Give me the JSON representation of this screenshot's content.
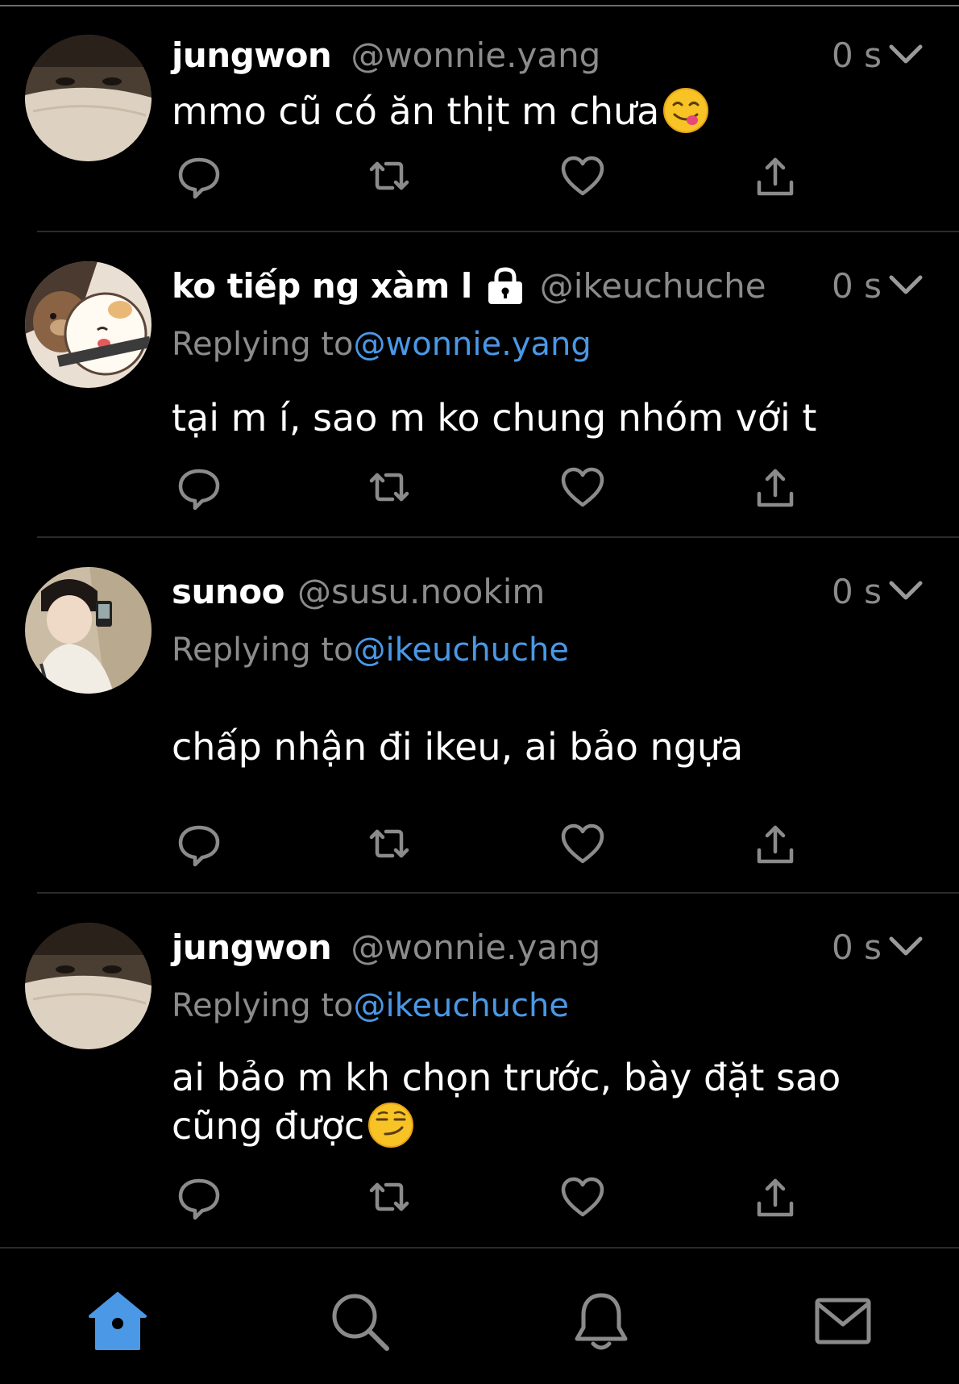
{
  "tweets": [
    {
      "name": "jungwon",
      "handle": "@wonnie.yang",
      "time": "0 s",
      "replying_prefix": "",
      "replying_to": "",
      "text": "mmo cũ có ăn thịt m chưa",
      "emoji": "savoring-face-emoji"
    },
    {
      "name": "ko tiếp ng xàm l",
      "handle": "@ikeuchuche",
      "time": "0 s",
      "replying_prefix": "Replying to",
      "replying_to": "@wonnie.yang",
      "text": "tại m í, sao m ko chung nhóm với t",
      "emoji": ""
    },
    {
      "name": "sunoo",
      "handle": "@susu.nookim",
      "time": "0 s",
      "replying_prefix": "Replying to",
      "replying_to": "@ikeuchuche",
      "text": "chấp nhận đi ikeu, ai bảo ngựa",
      "emoji": ""
    },
    {
      "name": "jungwon",
      "handle": "@wonnie.yang",
      "time": "0 s",
      "replying_prefix": "Replying to",
      "replying_to": "@ikeuchuche",
      "text_line1": "ai bảo m kh chọn trước, bày đặt sao",
      "text_line2": "cũng được",
      "emoji": "smirking-face-emoji"
    }
  ],
  "actions": [
    "reply-icon",
    "retweet-icon",
    "like-icon",
    "share-icon"
  ],
  "tabs": [
    "home-icon",
    "search-icon",
    "notifications-icon",
    "messages-icon"
  ],
  "colors": {
    "background": "#000000",
    "accent": "#4a98e6",
    "muted": "#8b8b8b",
    "divider": "#2b2b2b"
  }
}
